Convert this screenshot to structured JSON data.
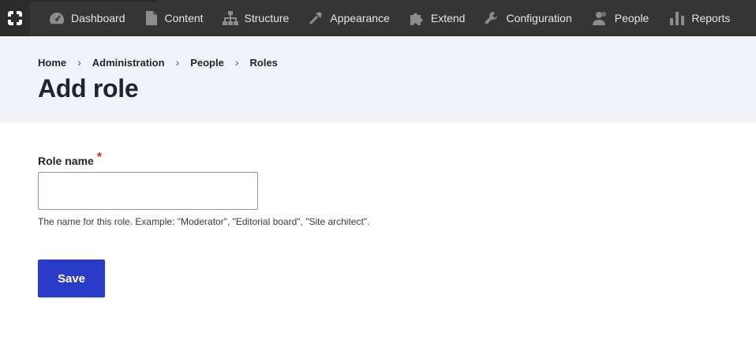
{
  "toolbar": {
    "home_icon": "drupal-home-icon",
    "items": [
      {
        "label": "Dashboard",
        "icon": "dashboard-gauge-icon"
      },
      {
        "label": "Content",
        "icon": "document-icon"
      },
      {
        "label": "Structure",
        "icon": "sitemap-icon"
      },
      {
        "label": "Appearance",
        "icon": "paintbrush-icon"
      },
      {
        "label": "Extend",
        "icon": "puzzle-icon"
      },
      {
        "label": "Configuration",
        "icon": "wrench-icon"
      },
      {
        "label": "People",
        "icon": "people-icon"
      },
      {
        "label": "Reports",
        "icon": "bar-chart-icon"
      }
    ]
  },
  "breadcrumb": [
    "Home",
    "Administration",
    "People",
    "Roles"
  ],
  "breadcrumb_separator": "›",
  "page_title": "Add role",
  "form": {
    "role_name_label": "Role name",
    "required_marker": "*",
    "role_name_value": "",
    "description": "The name for this role. Example: \"Moderator\", \"Editorial board\", \"Site architect\".",
    "save_label": "Save"
  },
  "colors": {
    "toolbar_bg": "#353535",
    "header_bg": "#f3f4f9",
    "primary_button": "#2a3bc8",
    "required": "#dc2323"
  }
}
